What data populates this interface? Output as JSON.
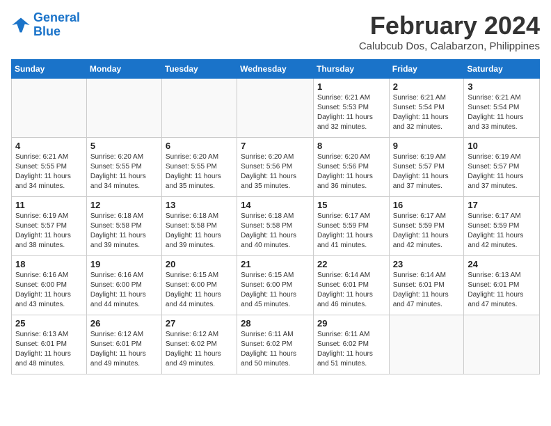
{
  "logo": {
    "line1": "General",
    "line2": "Blue"
  },
  "title": "February 2024",
  "subtitle": "Calubcub Dos, Calabarzon, Philippines",
  "headers": [
    "Sunday",
    "Monday",
    "Tuesday",
    "Wednesday",
    "Thursday",
    "Friday",
    "Saturday"
  ],
  "weeks": [
    [
      {
        "day": "",
        "info": ""
      },
      {
        "day": "",
        "info": ""
      },
      {
        "day": "",
        "info": ""
      },
      {
        "day": "",
        "info": ""
      },
      {
        "day": "1",
        "info": "Sunrise: 6:21 AM\nSunset: 5:53 PM\nDaylight: 11 hours\nand 32 minutes."
      },
      {
        "day": "2",
        "info": "Sunrise: 6:21 AM\nSunset: 5:54 PM\nDaylight: 11 hours\nand 32 minutes."
      },
      {
        "day": "3",
        "info": "Sunrise: 6:21 AM\nSunset: 5:54 PM\nDaylight: 11 hours\nand 33 minutes."
      }
    ],
    [
      {
        "day": "4",
        "info": "Sunrise: 6:21 AM\nSunset: 5:55 PM\nDaylight: 11 hours\nand 34 minutes."
      },
      {
        "day": "5",
        "info": "Sunrise: 6:20 AM\nSunset: 5:55 PM\nDaylight: 11 hours\nand 34 minutes."
      },
      {
        "day": "6",
        "info": "Sunrise: 6:20 AM\nSunset: 5:55 PM\nDaylight: 11 hours\nand 35 minutes."
      },
      {
        "day": "7",
        "info": "Sunrise: 6:20 AM\nSunset: 5:56 PM\nDaylight: 11 hours\nand 35 minutes."
      },
      {
        "day": "8",
        "info": "Sunrise: 6:20 AM\nSunset: 5:56 PM\nDaylight: 11 hours\nand 36 minutes."
      },
      {
        "day": "9",
        "info": "Sunrise: 6:19 AM\nSunset: 5:57 PM\nDaylight: 11 hours\nand 37 minutes."
      },
      {
        "day": "10",
        "info": "Sunrise: 6:19 AM\nSunset: 5:57 PM\nDaylight: 11 hours\nand 37 minutes."
      }
    ],
    [
      {
        "day": "11",
        "info": "Sunrise: 6:19 AM\nSunset: 5:57 PM\nDaylight: 11 hours\nand 38 minutes."
      },
      {
        "day": "12",
        "info": "Sunrise: 6:18 AM\nSunset: 5:58 PM\nDaylight: 11 hours\nand 39 minutes."
      },
      {
        "day": "13",
        "info": "Sunrise: 6:18 AM\nSunset: 5:58 PM\nDaylight: 11 hours\nand 39 minutes."
      },
      {
        "day": "14",
        "info": "Sunrise: 6:18 AM\nSunset: 5:58 PM\nDaylight: 11 hours\nand 40 minutes."
      },
      {
        "day": "15",
        "info": "Sunrise: 6:17 AM\nSunset: 5:59 PM\nDaylight: 11 hours\nand 41 minutes."
      },
      {
        "day": "16",
        "info": "Sunrise: 6:17 AM\nSunset: 5:59 PM\nDaylight: 11 hours\nand 42 minutes."
      },
      {
        "day": "17",
        "info": "Sunrise: 6:17 AM\nSunset: 5:59 PM\nDaylight: 11 hours\nand 42 minutes."
      }
    ],
    [
      {
        "day": "18",
        "info": "Sunrise: 6:16 AM\nSunset: 6:00 PM\nDaylight: 11 hours\nand 43 minutes."
      },
      {
        "day": "19",
        "info": "Sunrise: 6:16 AM\nSunset: 6:00 PM\nDaylight: 11 hours\nand 44 minutes."
      },
      {
        "day": "20",
        "info": "Sunrise: 6:15 AM\nSunset: 6:00 PM\nDaylight: 11 hours\nand 44 minutes."
      },
      {
        "day": "21",
        "info": "Sunrise: 6:15 AM\nSunset: 6:00 PM\nDaylight: 11 hours\nand 45 minutes."
      },
      {
        "day": "22",
        "info": "Sunrise: 6:14 AM\nSunset: 6:01 PM\nDaylight: 11 hours\nand 46 minutes."
      },
      {
        "day": "23",
        "info": "Sunrise: 6:14 AM\nSunset: 6:01 PM\nDaylight: 11 hours\nand 47 minutes."
      },
      {
        "day": "24",
        "info": "Sunrise: 6:13 AM\nSunset: 6:01 PM\nDaylight: 11 hours\nand 47 minutes."
      }
    ],
    [
      {
        "day": "25",
        "info": "Sunrise: 6:13 AM\nSunset: 6:01 PM\nDaylight: 11 hours\nand 48 minutes."
      },
      {
        "day": "26",
        "info": "Sunrise: 6:12 AM\nSunset: 6:01 PM\nDaylight: 11 hours\nand 49 minutes."
      },
      {
        "day": "27",
        "info": "Sunrise: 6:12 AM\nSunset: 6:02 PM\nDaylight: 11 hours\nand 49 minutes."
      },
      {
        "day": "28",
        "info": "Sunrise: 6:11 AM\nSunset: 6:02 PM\nDaylight: 11 hours\nand 50 minutes."
      },
      {
        "day": "29",
        "info": "Sunrise: 6:11 AM\nSunset: 6:02 PM\nDaylight: 11 hours\nand 51 minutes."
      },
      {
        "day": "",
        "info": ""
      },
      {
        "day": "",
        "info": ""
      }
    ]
  ]
}
